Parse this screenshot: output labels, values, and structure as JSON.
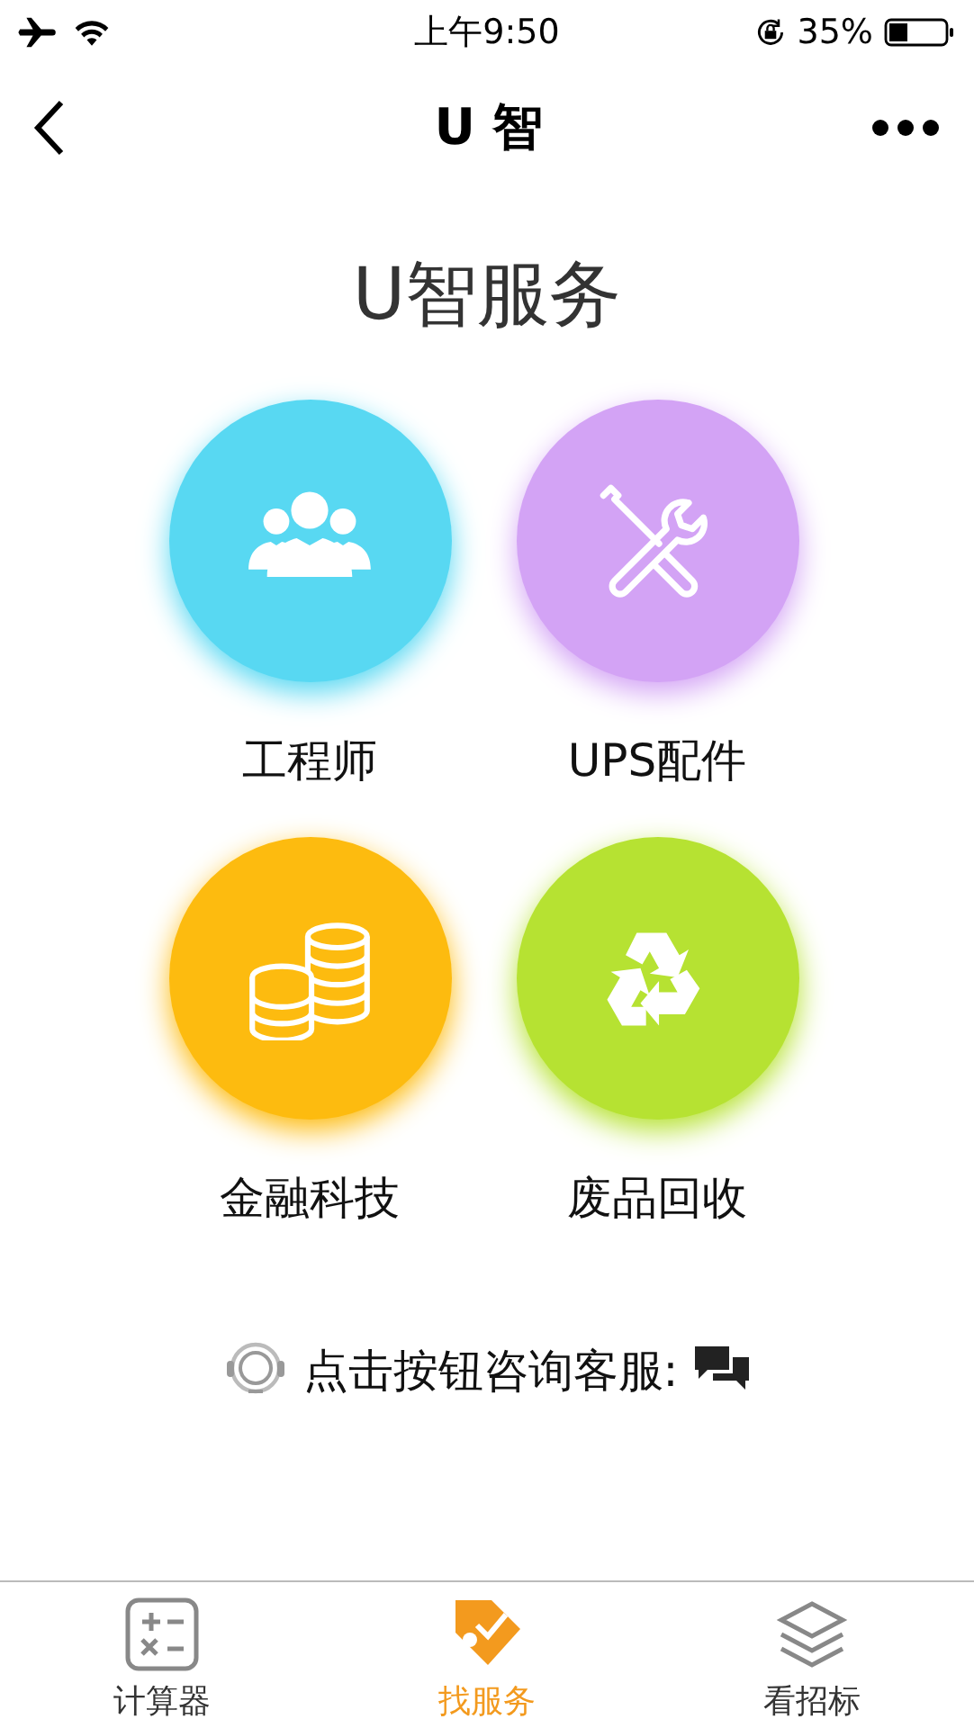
{
  "status_bar": {
    "time": "上午9:50",
    "battery": "35%"
  },
  "nav": {
    "title": "U 智"
  },
  "heading": "U智服务",
  "services": [
    {
      "label": "工程师",
      "kind": "people",
      "color": "#58d8f2"
    },
    {
      "label": "UPS配件",
      "kind": "tools",
      "color": "#d3a3f5"
    },
    {
      "label": "金融科技",
      "kind": "coins",
      "color": "#fdbb0f"
    },
    {
      "label": "废品回收",
      "kind": "recycle",
      "color": "#b6e232"
    }
  ],
  "consult": {
    "text": "点击按钮咨询客服:"
  },
  "tabs": [
    {
      "label": "计算器",
      "kind": "calculator",
      "selected": false
    },
    {
      "label": "找服务",
      "kind": "service",
      "selected": true
    },
    {
      "label": "看招标",
      "kind": "layers",
      "selected": false
    }
  ]
}
